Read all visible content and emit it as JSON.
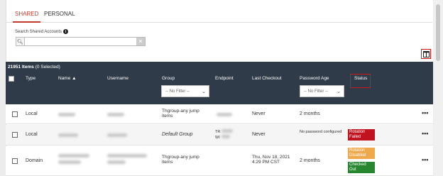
{
  "tabs": [
    {
      "label": "SHARED",
      "active": true
    },
    {
      "label": "PERSONAL",
      "active": false
    }
  ],
  "search": {
    "label": "Search Shared Accounts",
    "value": ""
  },
  "grid": {
    "item_count": "21951 Items",
    "selected_text": "(0 Selected)",
    "headers": {
      "type": "Type",
      "name": "Name",
      "username": "Username",
      "group": "Group",
      "endpoint": "Endpoint",
      "last_checkout": "Last Checkout",
      "password_age": "Password Age",
      "status": "Status"
    },
    "group_filter": "-- No Filter --",
    "password_age_filter": "-- No Filter --"
  },
  "rows": [
    {
      "type": "Local",
      "group": "Thgroup-any jump items",
      "last_checkout": "Never",
      "password_age": "2 months",
      "status": []
    },
    {
      "type": "Local",
      "group": "Default Group",
      "endpoint_prefix": "TR",
      "endpoint_prefix2": "WI",
      "last_checkout": "Never",
      "password_age": "No password configured",
      "status": [
        {
          "text": "Rotation Failed",
          "color": "#c1121f"
        }
      ]
    },
    {
      "type": "Domain",
      "group": "Thgroup-any jump items",
      "last_checkout": "Thu, Nov 18, 2021 4:29 PM CST",
      "password_age": "2 months",
      "status": [
        {
          "text": "Rotation Disabled",
          "color": "#f0a94a"
        },
        {
          "text": "Checked Out",
          "color": "#27862f"
        }
      ]
    }
  ],
  "icons": {
    "info": "info-icon",
    "search": "search-icon",
    "clear": "clear-icon",
    "columns": "columns-icon",
    "sort": "sort-up-icon",
    "more": "more-icon"
  },
  "colors": {
    "accent": "#c0392b",
    "header_bg": "#2f3b48",
    "highlight": "#d01818"
  }
}
